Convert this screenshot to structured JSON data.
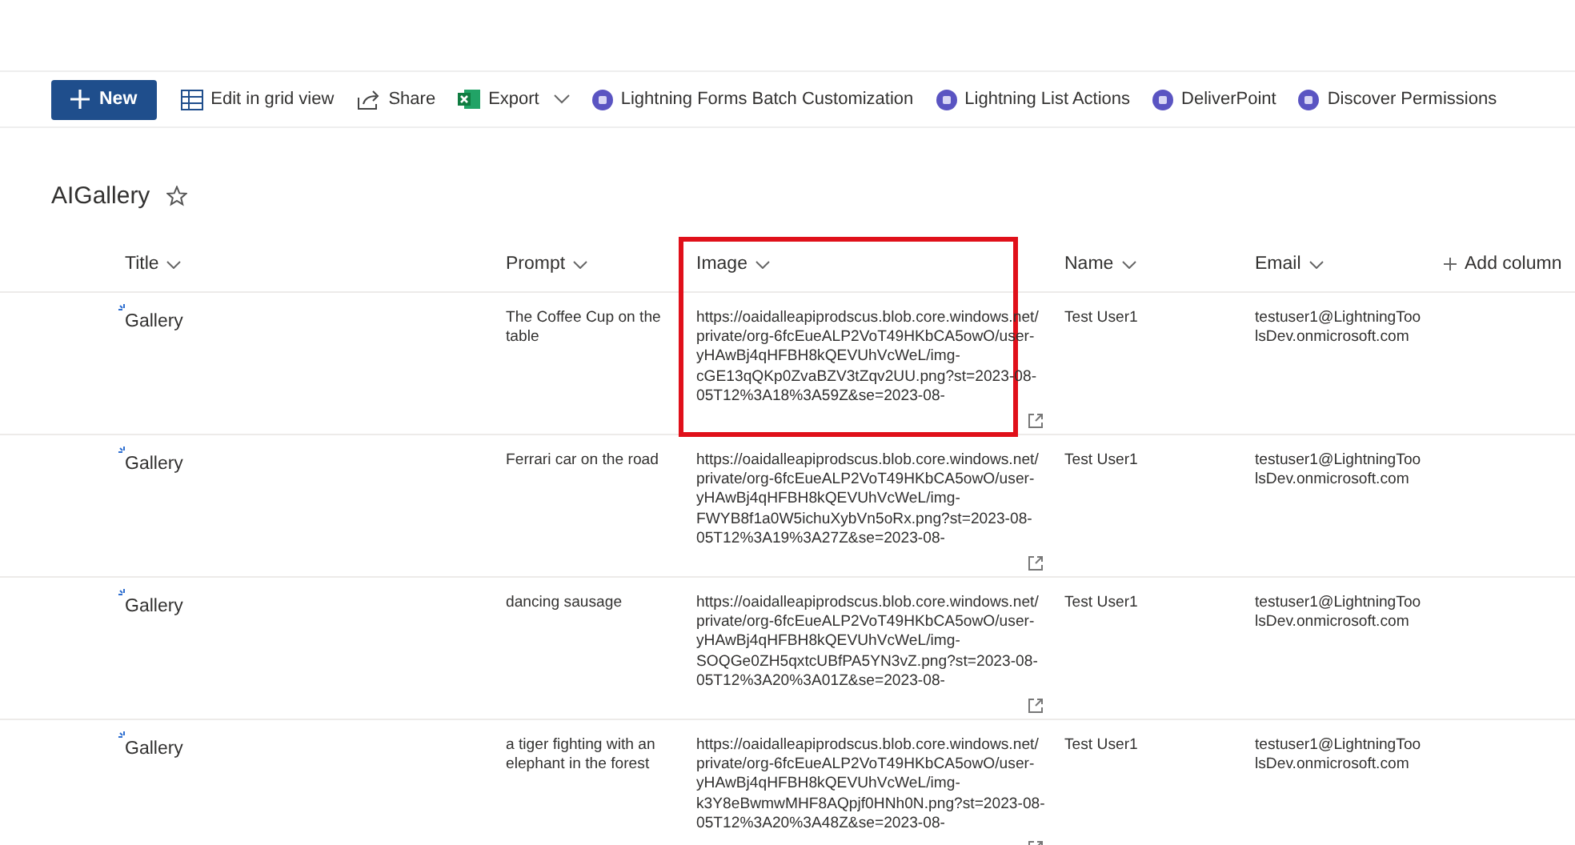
{
  "toolbar": {
    "new_button": "New",
    "items": [
      {
        "kind": "grid",
        "label": "Edit in grid view",
        "dropdown": false
      },
      {
        "kind": "share",
        "label": "Share",
        "dropdown": false
      },
      {
        "kind": "excel",
        "label": "Export",
        "dropdown": true
      },
      {
        "kind": "app",
        "label": "Lightning Forms Batch Customization",
        "dropdown": false
      },
      {
        "kind": "app",
        "label": "Lightning List Actions",
        "dropdown": false
      },
      {
        "kind": "app",
        "label": "DeliverPoint",
        "dropdown": false
      },
      {
        "kind": "app",
        "label": "Discover Permissions",
        "dropdown": false
      }
    ]
  },
  "list": {
    "title": "AIGallery",
    "favorite": false,
    "columns": [
      {
        "label": "Title",
        "highlighted": false
      },
      {
        "label": "Prompt",
        "highlighted": false
      },
      {
        "label": "Image",
        "highlighted": true
      },
      {
        "label": "Name",
        "highlighted": false
      },
      {
        "label": "Email",
        "highlighted": false
      }
    ],
    "add_column": "Add column",
    "rows": [
      {
        "new": true,
        "title": "Gallery",
        "prompt": "The Coffee Cup on the table",
        "image": [
          "https://oaidalleapiprodscus.blob.core.windows.net/",
          "private/org-6fcEueALP2VoT49HKbCA5owO/user-",
          "yHAwBj4qHFBH8kQEVUhVcWeL/img-",
          "cGE13qQKp0ZvaBZV3tZqv2UU.png?st=2023-08-",
          "05T12%3A18%3A59Z&se=2023-08-"
        ],
        "name": "Test User1",
        "email": [
          "testuser1@LightningToo",
          "lsDev.onmicrosoft.com"
        ]
      },
      {
        "new": true,
        "title": "Gallery",
        "prompt": "Ferrari car on the road",
        "image": [
          "https://oaidalleapiprodscus.blob.core.windows.net/",
          "private/org-6fcEueALP2VoT49HKbCA5owO/user-",
          "yHAwBj4qHFBH8kQEVUhVcWeL/img-",
          "FWYB8f1a0W5ichuXybVn5oRx.png?st=2023-08-",
          "05T12%3A19%3A27Z&se=2023-08-"
        ],
        "name": "Test User1",
        "email": [
          "testuser1@LightningToo",
          "lsDev.onmicrosoft.com"
        ]
      },
      {
        "new": true,
        "title": "Gallery",
        "prompt": "dancing sausage",
        "image": [
          "https://oaidalleapiprodscus.blob.core.windows.net/",
          "private/org-6fcEueALP2VoT49HKbCA5owO/user-",
          "yHAwBj4qHFBH8kQEVUhVcWeL/img-",
          "SOQGe0ZH5qxtcUBfPA5YN3vZ.png?st=2023-08-",
          "05T12%3A20%3A01Z&se=2023-08-"
        ],
        "name": "Test User1",
        "email": [
          "testuser1@LightningToo",
          "lsDev.onmicrosoft.com"
        ]
      },
      {
        "new": true,
        "title": "Gallery",
        "prompt": "a tiger fighting with an elephant in the forest",
        "image": [
          "https://oaidalleapiprodscus.blob.core.windows.net/",
          "private/org-6fcEueALP2VoT49HKbCA5owO/user-",
          "yHAwBj4qHFBH8kQEVUhVcWeL/img-",
          "k3Y8eBwmwMHF8AQpjf0HNh0N.png?st=2023-08-",
          "05T12%3A20%3A48Z&se=2023-08-"
        ],
        "name": "Test User1",
        "email": [
          "testuser1@LightningToo",
          "lsDev.onmicrosoft.com"
        ]
      }
    ]
  }
}
